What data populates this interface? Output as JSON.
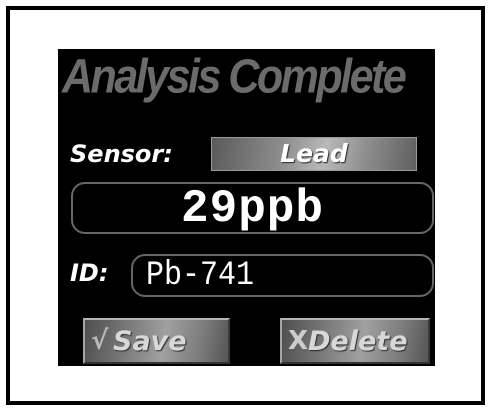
{
  "screen": {
    "title": "Analysis Complete",
    "sensor": {
      "label": "Sensor:",
      "value": "Lead"
    },
    "reading": {
      "value": "29ppb"
    },
    "id_field": {
      "label": "ID:",
      "value": "Pb-741"
    },
    "buttons": {
      "save": {
        "icon": "checkmark-icon",
        "glyph": "√",
        "label": "Save"
      },
      "delete": {
        "icon": "x-icon",
        "glyph": "X",
        "label": "Delete"
      }
    }
  },
  "colors": {
    "background": "#000000",
    "title": "#6b6b6b",
    "text": "#ffffff",
    "field_border": "#666666"
  }
}
